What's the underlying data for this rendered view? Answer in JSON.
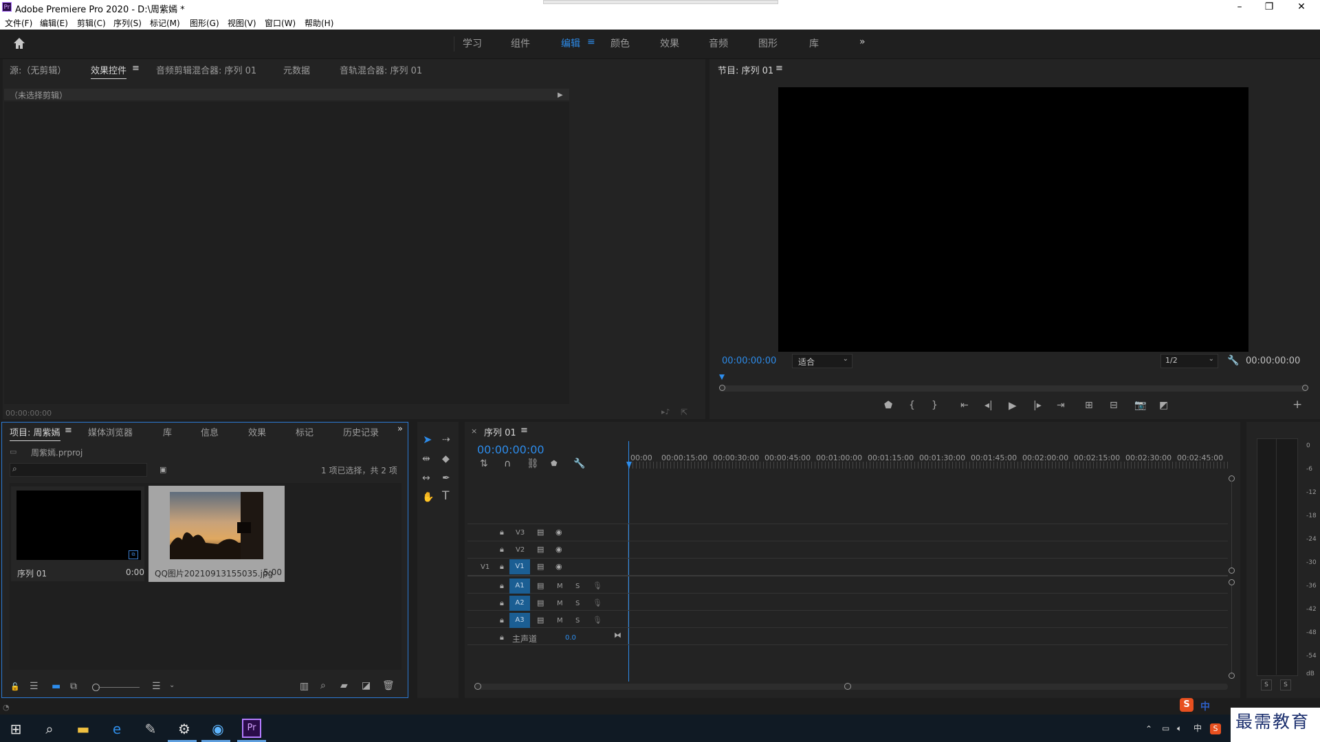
{
  "window": {
    "title": "Adobe Premiere Pro 2020 - D:\\周紫嫣 *",
    "app_icon": "Pr",
    "controls": [
      "–",
      "❐",
      "✕"
    ]
  },
  "menu": [
    "文件(F)",
    "编辑(E)",
    "剪辑(C)",
    "序列(S)",
    "标记(M)",
    "图形(G)",
    "视图(V)",
    "窗口(W)",
    "帮助(H)"
  ],
  "workspaces": {
    "items": [
      "学习",
      "组件",
      "编辑",
      "颜色",
      "效果",
      "音频",
      "图形",
      "库"
    ],
    "active": "编辑",
    "more": "»"
  },
  "source_panel": {
    "tabs": [
      "源:（无剪辑）",
      "效果控件",
      "音频剪辑混合器: 序列 01",
      "元数据",
      "音轨混合器: 序列 01"
    ],
    "active_tab": "效果控件",
    "no_clip": "（未选择剪辑）",
    "timecode": "00:00:00:00"
  },
  "program_monitor": {
    "title": "节目: 序列 01",
    "timecode_left": "00:00:00:00",
    "fit": "适合",
    "resolution": "1/2",
    "timecode_right": "00:00:00:00"
  },
  "project_panel": {
    "tabs": [
      "项目: 周紫嫣",
      "媒体浏览器",
      "库",
      "信息",
      "效果",
      "标记",
      "历史记录"
    ],
    "project_file": "周紫嫣.prproj",
    "selection_status": "1 项已选择，共 2 项",
    "items": [
      {
        "name": "序列 01",
        "duration": "0:00"
      },
      {
        "name": "QQ图片20210913155035.jpg",
        "duration": "5:00"
      }
    ]
  },
  "timeline": {
    "tab": "序列 01",
    "timecode": "00:00:00:00",
    "ruler": [
      "00:00",
      "00:00:15:00",
      "00:00:30:00",
      "00:00:45:00",
      "00:01:00:00",
      "00:01:15:00",
      "00:01:30:00",
      "00:01:45:00",
      "00:02:00:00",
      "00:02:15:00",
      "00:02:30:00",
      "00:02:45:00"
    ],
    "video_tracks": [
      "V3",
      "V2",
      "V1"
    ],
    "source_patch": "V1",
    "audio_tracks": [
      "A1",
      "A2",
      "A3"
    ],
    "mute": "M",
    "solo": "S",
    "master": {
      "label": "主声道",
      "value": "0.0"
    }
  },
  "audio_meter": {
    "scale": [
      "0",
      "-6",
      "-12",
      "-18",
      "-24",
      "-30",
      "-36",
      "-42",
      "-48",
      "-54",
      "dB"
    ],
    "solo_buttons": [
      "S",
      "S"
    ]
  },
  "ime": {
    "label": "中"
  },
  "watermark": "最需教育",
  "colors": {
    "accent": "#2d8ceb",
    "track_blue": "#1b5e93",
    "panel": "#232323"
  }
}
